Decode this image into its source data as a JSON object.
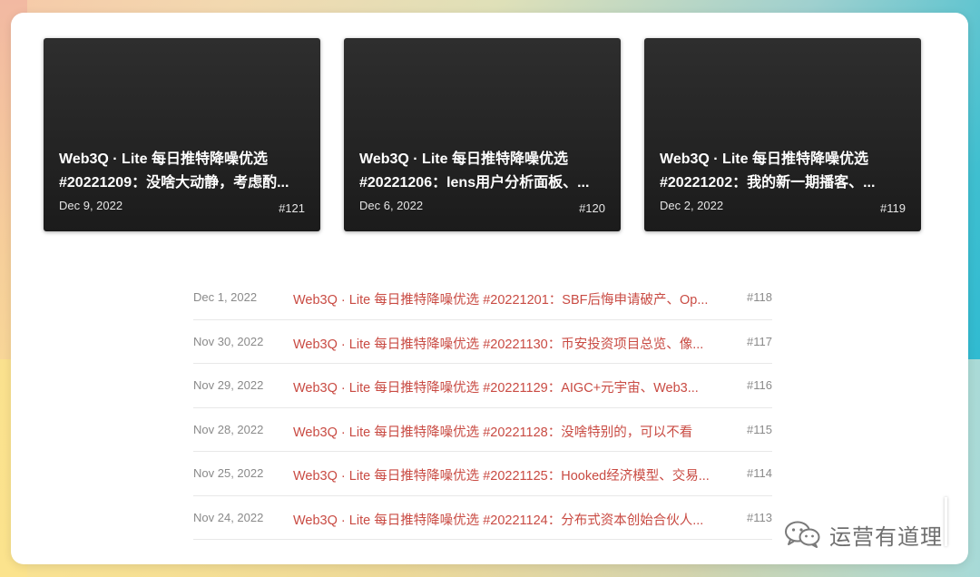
{
  "featured": [
    {
      "title_line1": "Web3Q · Lite 每日推特降噪优选",
      "title_line2": "#20221209：没啥大动静，考虑酌...",
      "date": "Dec 9, 2022",
      "number": "#121"
    },
    {
      "title_line1": "Web3Q · Lite 每日推特降噪优选",
      "title_line2": "#20221206：lens用户分析面板、...",
      "date": "Dec 6, 2022",
      "number": "#120"
    },
    {
      "title_line1": "Web3Q · Lite 每日推特降噪优选",
      "title_line2": "#20221202：我的新一期播客、...",
      "date": "Dec 2, 2022",
      "number": "#119"
    }
  ],
  "list": [
    {
      "date": "Dec 1, 2022",
      "title": "Web3Q · Lite 每日推特降噪优选 #20221201：SBF后悔申请破产、Op...",
      "number": "#118"
    },
    {
      "date": "Nov 30, 2022",
      "title": "Web3Q · Lite 每日推特降噪优选 #20221130：币安投资项目总览、像...",
      "number": "#117"
    },
    {
      "date": "Nov 29, 2022",
      "title": "Web3Q · Lite 每日推特降噪优选 #20221129：AIGC+元宇宙、Web3...",
      "number": "#116"
    },
    {
      "date": "Nov 28, 2022",
      "title": "Web3Q · Lite 每日推特降噪优选 #20221128：没啥特别的，可以不看",
      "number": "#115"
    },
    {
      "date": "Nov 25, 2022",
      "title": "Web3Q · Lite 每日推特降噪优选 #20221125：Hooked经济模型、交易...",
      "number": "#114"
    },
    {
      "date": "Nov 24, 2022",
      "title": "Web3Q · Lite 每日推特降噪优选 #20221124：分布式资本创始合伙人...",
      "number": "#113"
    }
  ],
  "watermark": {
    "text": "运营有道理",
    "icon": "wechat-icon"
  },
  "colors": {
    "link": "#c94b43",
    "muted": "#8a8a8a",
    "card_bg": "#252525"
  }
}
